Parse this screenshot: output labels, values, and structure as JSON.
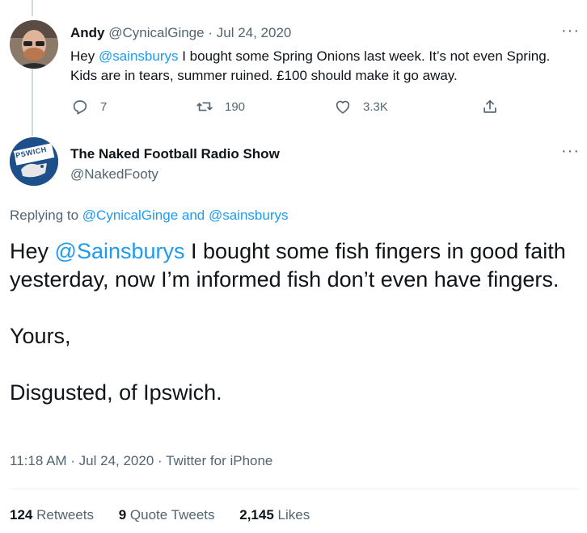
{
  "tweet1": {
    "display_name": "Andy",
    "handle": "@CynicalGinge",
    "separator": "·",
    "date": "Jul 24, 2020",
    "text_before": "Hey ",
    "mention": "@sainsburys",
    "text_after": " I bought some Spring Onions last week. It’s not even Spring. Kids are in tears, summer ruined. £100 should make it go away.",
    "reply_count": "7",
    "retweet_count": "190",
    "like_count": "3.3K",
    "more_label": "···"
  },
  "tweet2": {
    "display_name": "The Naked Football Radio Show",
    "handle": "@NakedFooty",
    "more_label": "···",
    "avatar_text": "IPSWICH",
    "replying_prefix": "Replying to ",
    "replying_user1": "@CynicalGinge",
    "replying_and": " and ",
    "replying_user2": "@sainsburys",
    "line1_before": "Hey ",
    "line1_mention": "@Sainsburys",
    "line1_after": " I bought some fish fingers in good faith yesterday, now I’m informed fish don’t even have fingers.",
    "line2": "Yours,",
    "line3": "Disgusted, of Ipswich.",
    "meta": "11:18 AM · Jul 24, 2020 · Twitter for iPhone",
    "retweets_count": "124",
    "retweets_label": "Retweets",
    "quotes_count": "9",
    "quotes_label": "Quote Tweets",
    "likes_count": "2,145",
    "likes_label": "Likes"
  },
  "colors": {
    "link": "#1d9bf0",
    "muted": "#536471",
    "text": "#0f1419"
  }
}
